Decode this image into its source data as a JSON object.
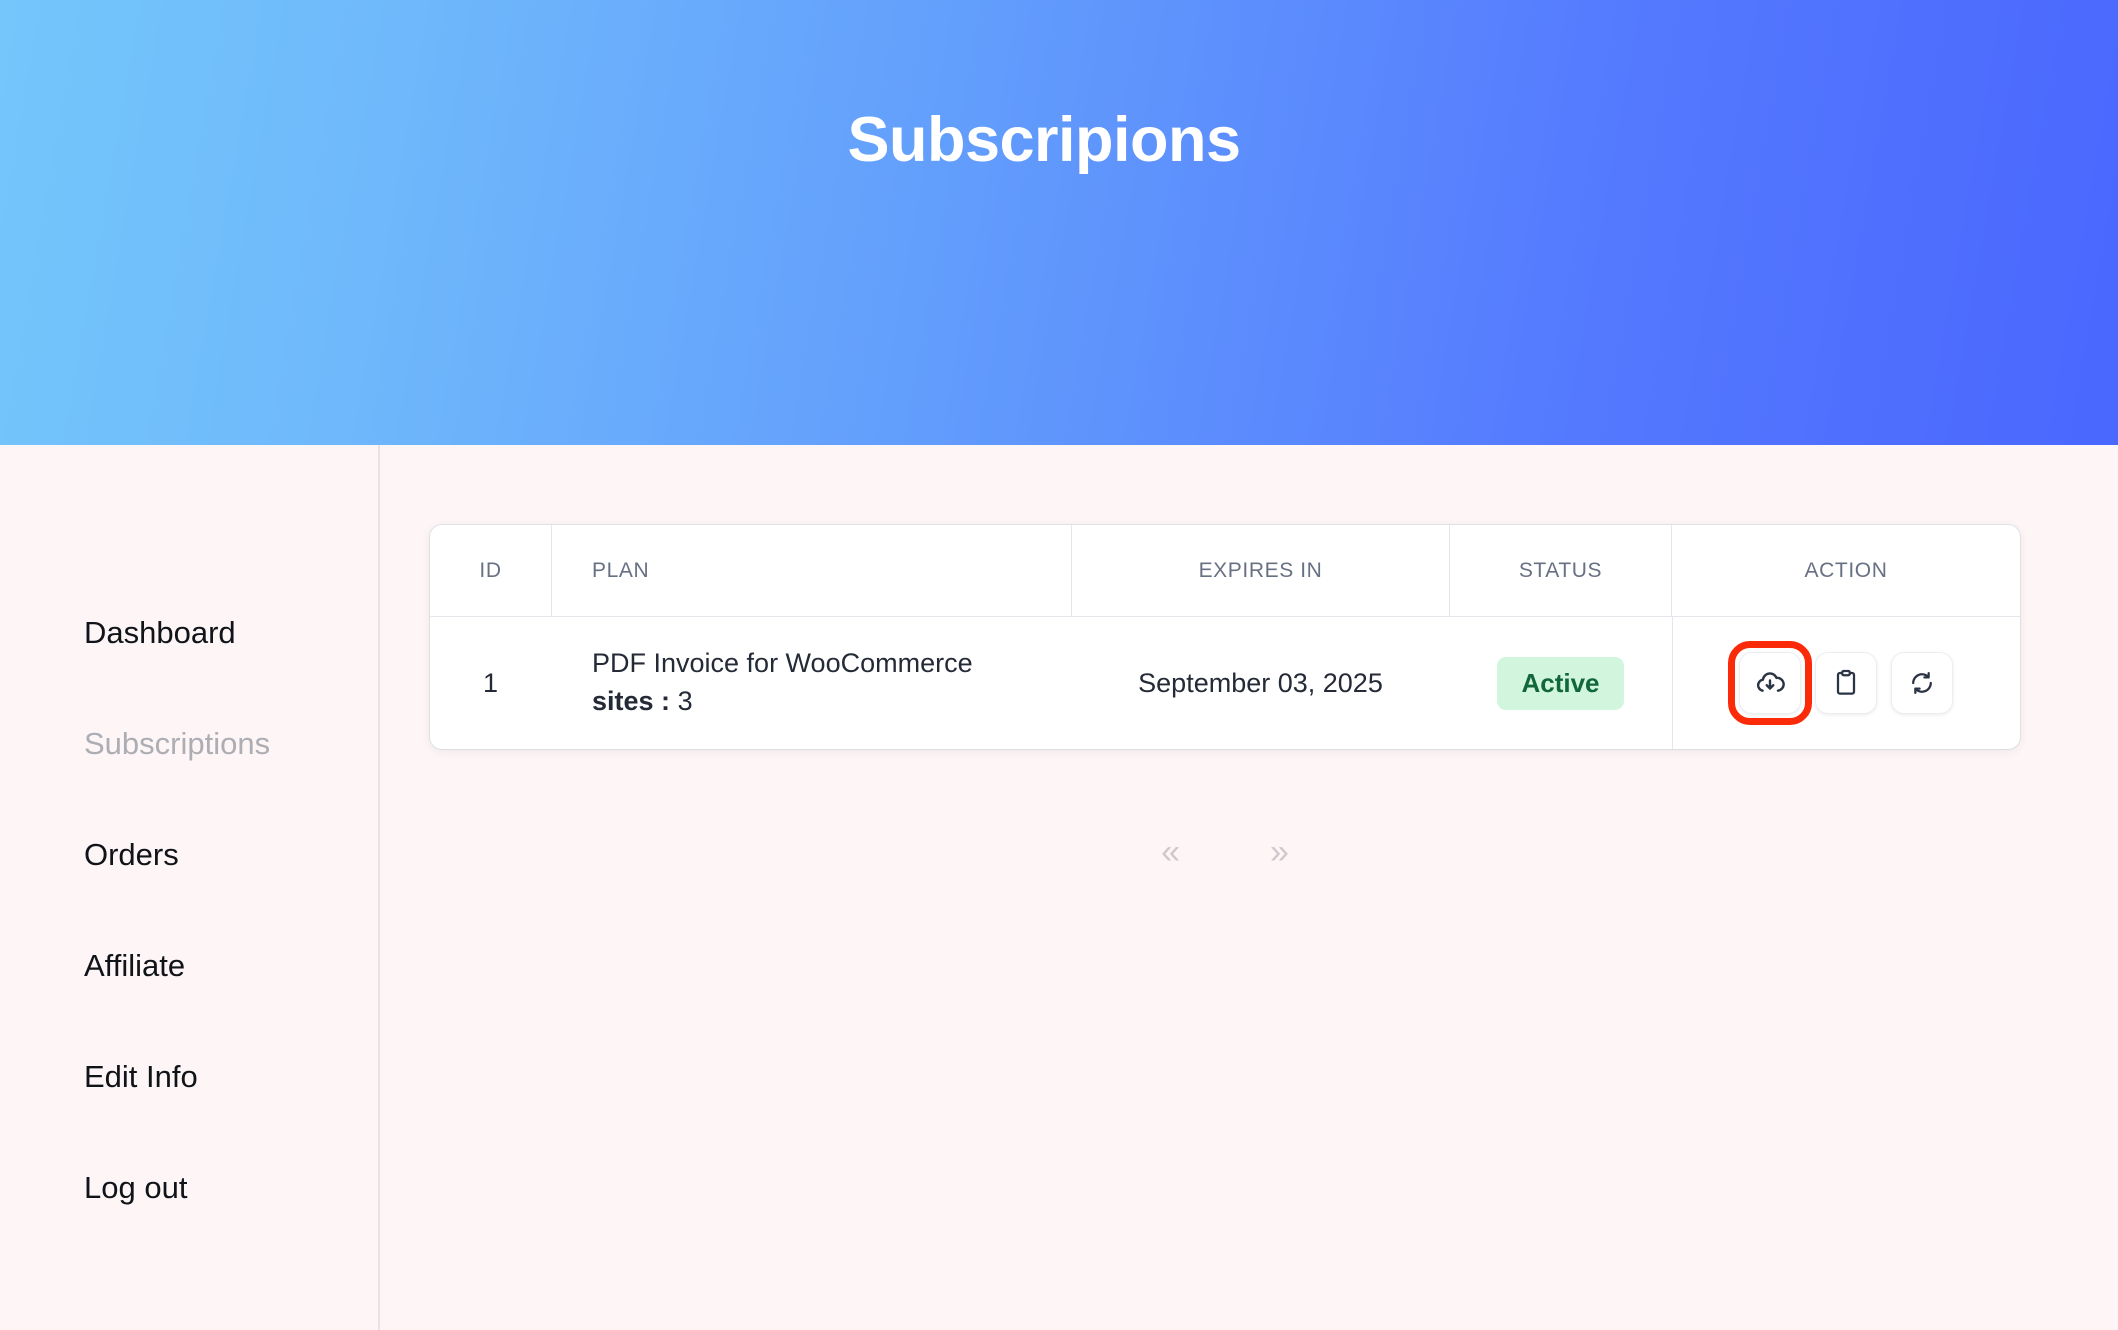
{
  "hero": {
    "title": "Subscripions",
    "gradient_from": "#74c6fb",
    "gradient_to": "#4a67fe"
  },
  "sidebar": {
    "items": [
      {
        "label": "Dashboard",
        "active": false
      },
      {
        "label": "Subscriptions",
        "active": true
      },
      {
        "label": "Orders",
        "active": false
      },
      {
        "label": "Affiliate",
        "active": false
      },
      {
        "label": "Edit Info",
        "active": false
      },
      {
        "label": "Log out",
        "active": false
      }
    ]
  },
  "table": {
    "columns": [
      "ID",
      "PLAN",
      "EXPIRES IN",
      "STATUS",
      "ACTION"
    ],
    "rows": [
      {
        "id": "1",
        "plan_name": "PDF Invoice for WooCommerce",
        "plan_meta_label": "sites :",
        "plan_meta_value": "3",
        "expires_in": "September 03, 2025",
        "status": "Active",
        "status_color": "#11663a",
        "status_bg": "#d2f5dd",
        "actions": [
          {
            "icon": "cloud-download-icon",
            "highlighted": true
          },
          {
            "icon": "clipboard-icon",
            "highlighted": false
          },
          {
            "icon": "refresh-icon",
            "highlighted": false
          }
        ]
      }
    ]
  },
  "pagination": {
    "prev_label": "«",
    "next_label": "»"
  },
  "annotation": {
    "color": "#fb2a09",
    "target": "cloud-download-icon"
  }
}
